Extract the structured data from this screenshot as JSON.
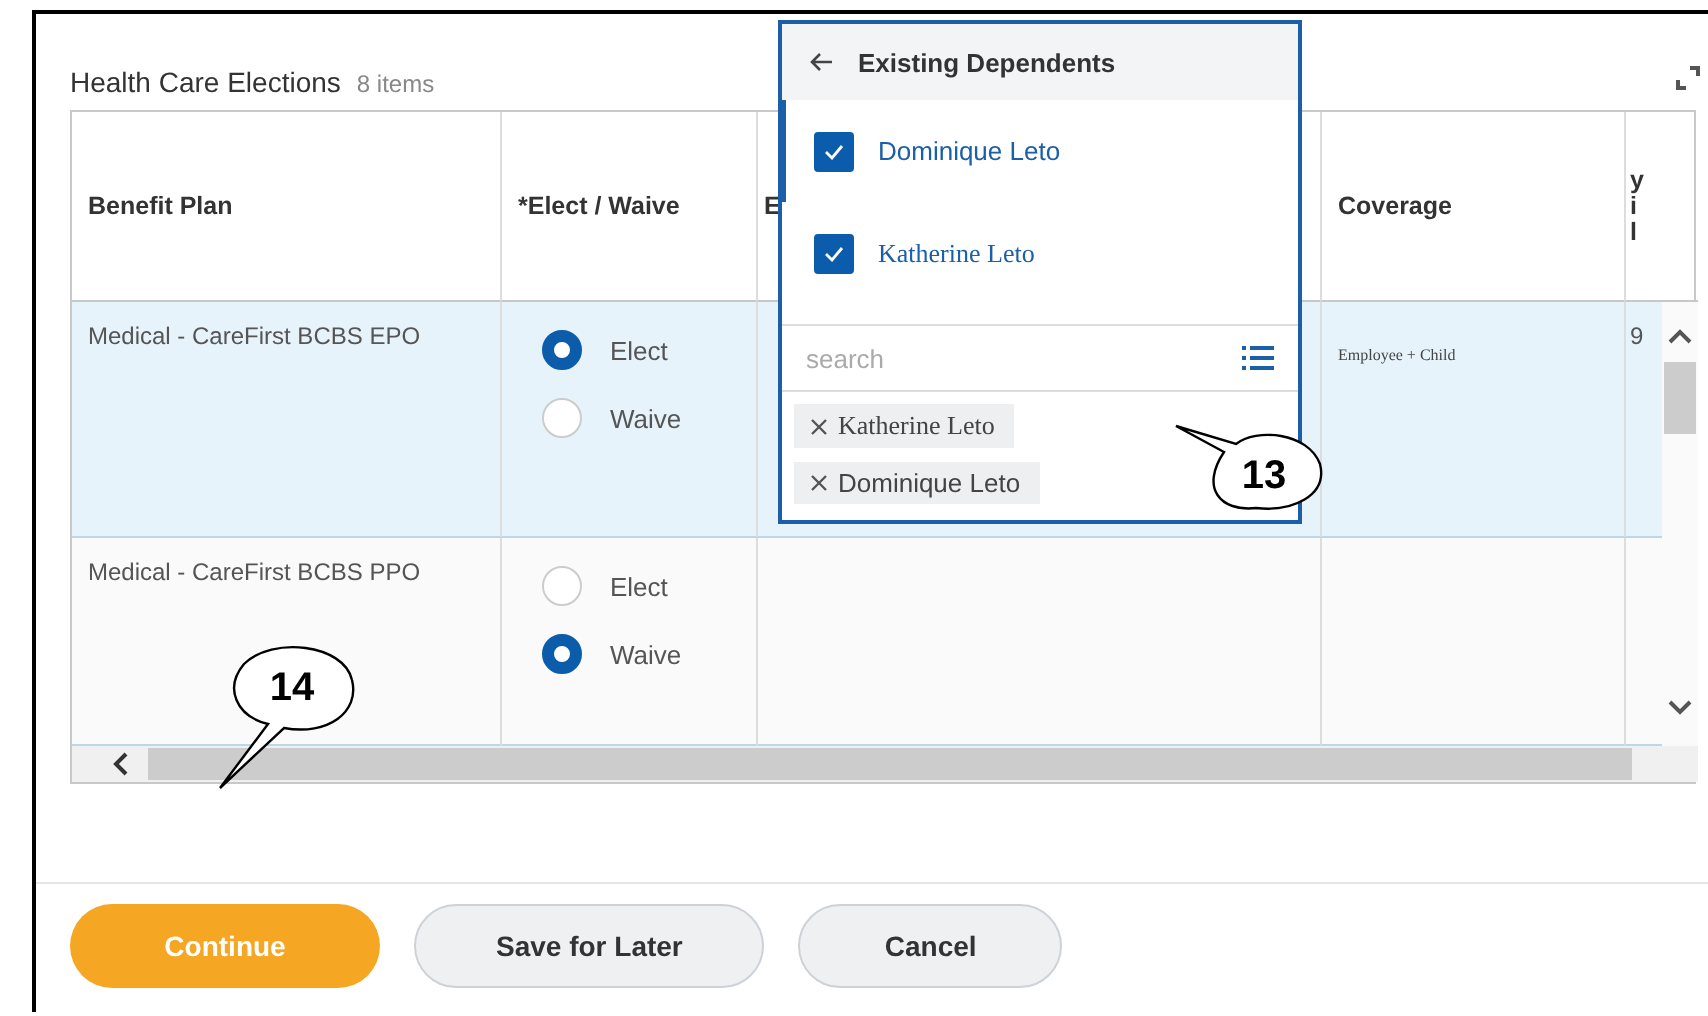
{
  "panel": {
    "title": "Health Care Elections",
    "count": "8 items"
  },
  "table": {
    "columns": [
      {
        "label": "Benefit Plan"
      },
      {
        "label": "*Elect / Waive"
      },
      {
        "label": "E"
      },
      {
        "label": "Coverage"
      },
      {
        "label_lines": [
          "y",
          "i",
          "l"
        ]
      }
    ],
    "rows": [
      {
        "plan": "Medical - CareFirst BCBS EPO",
        "selected": true,
        "options": [
          {
            "label": "Elect",
            "selected": true
          },
          {
            "label": "Waive",
            "selected": false
          }
        ],
        "coverage": "Employee + Child",
        "column_5": "9"
      },
      {
        "plan": "Medical - CareFirst BCBS PPO",
        "selected": false,
        "options": [
          {
            "label": "Elect",
            "selected": false
          },
          {
            "label": "Waive",
            "selected": true
          }
        ]
      }
    ]
  },
  "dropdown": {
    "title": "Existing Dependents",
    "options": [
      {
        "label": "Dominique Leto",
        "checked": true,
        "active": true
      },
      {
        "label": "Katherine Leto",
        "checked": true,
        "active": false
      }
    ],
    "search": {
      "placeholder": "search"
    },
    "chips": [
      "Katherine Leto",
      "Dominique Leto"
    ]
  },
  "buttons": [
    {
      "label": "Continue",
      "kind": "primary"
    },
    {
      "label": "Save for Later",
      "kind": "secondary"
    },
    {
      "label": "Cancel",
      "kind": "secondary"
    }
  ],
  "callouts": [
    "13",
    "14"
  ]
}
